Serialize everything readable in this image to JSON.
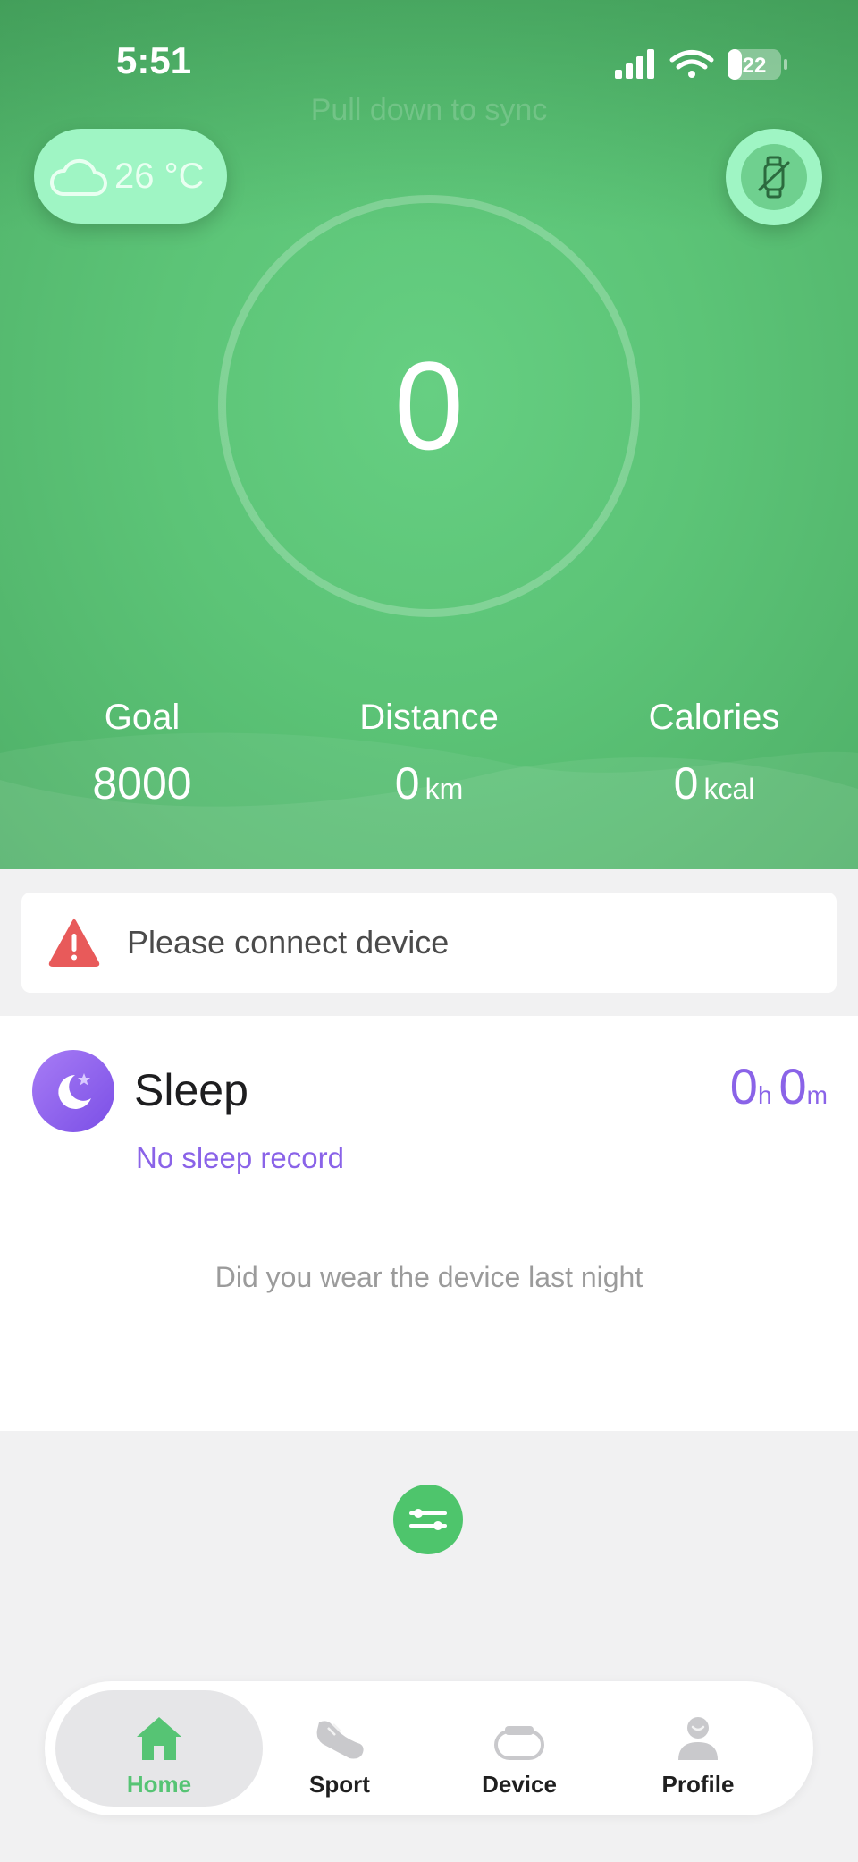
{
  "status_bar": {
    "time": "5:51",
    "battery": "22"
  },
  "header": {
    "sync_hint": "Pull down to sync",
    "weather": {
      "temperature": "26 °C",
      "icon": "cloud-icon"
    },
    "watch_icon": "watch-disconnected-icon",
    "steps": "0",
    "stats": [
      {
        "label": "Goal",
        "value": "8000",
        "unit": ""
      },
      {
        "label": "Distance",
        "value": "0",
        "unit": "km"
      },
      {
        "label": "Calories",
        "value": "0",
        "unit": "kcal"
      }
    ]
  },
  "alert": {
    "text": "Please connect device",
    "icon": "warning-icon"
  },
  "sleep": {
    "title": "Sleep",
    "hours": "0",
    "hours_unit": "h",
    "minutes": "0",
    "minutes_unit": "m",
    "status": "No sleep record",
    "hint": "Did you wear the device last night"
  },
  "tabs": [
    {
      "label": "Home",
      "icon": "home-icon",
      "active": true
    },
    {
      "label": "Sport",
      "icon": "shoe-icon",
      "active": false
    },
    {
      "label": "Device",
      "icon": "band-icon",
      "active": false
    },
    {
      "label": "Profile",
      "icon": "person-icon",
      "active": false
    }
  ],
  "colors": {
    "primary_green": "#5cc477",
    "accent_mint": "#9ff5c4",
    "sleep_purple": "#8a63e8",
    "warning_red": "#e85a5a"
  }
}
